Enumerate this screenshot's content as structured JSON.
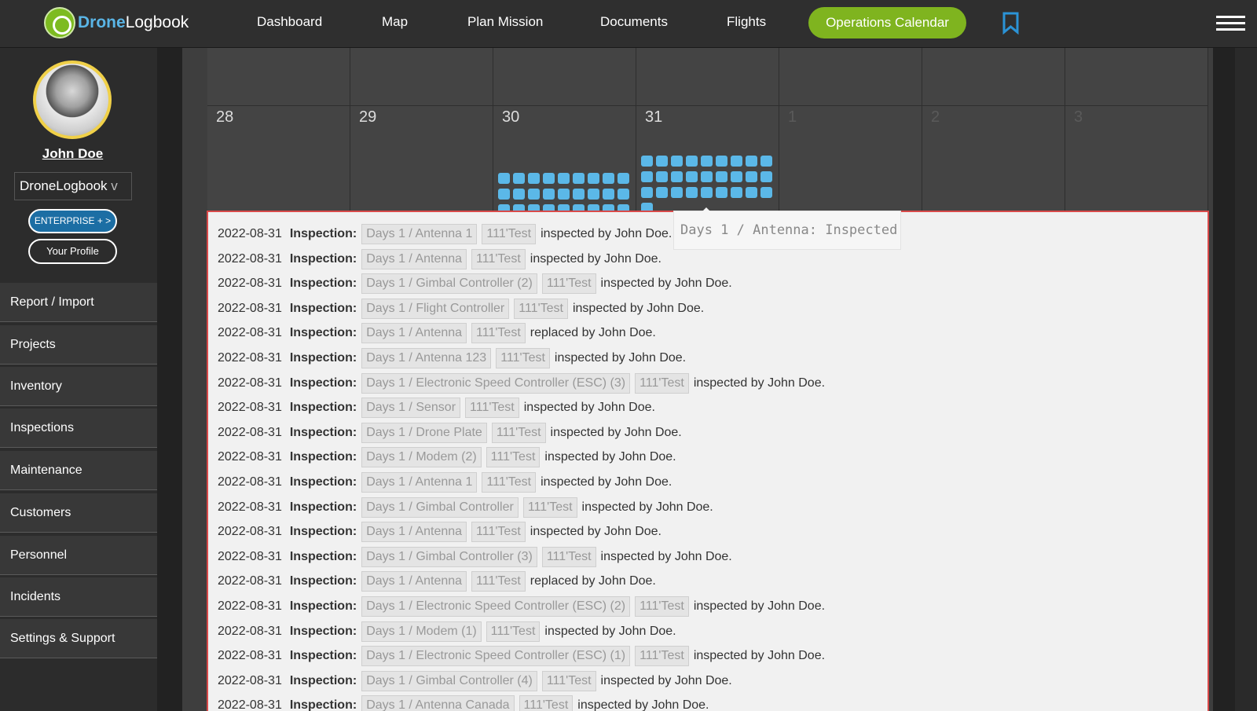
{
  "app": {
    "brand_a": "Drone",
    "brand_b": "Logbook"
  },
  "nav": [
    "Dashboard",
    "Map",
    "Plan Mission",
    "Documents",
    "Flights"
  ],
  "nav_cta": "Operations Calendar",
  "colors": {
    "accent_green": "#7fb41f",
    "brand_blue": "#5ab5e6",
    "badge_blue": "#5bb8e8",
    "highlight_red": "#d94a4a"
  },
  "user": {
    "name": "John Doe",
    "org": "DroneLogbook",
    "org_caret": "v",
    "plan_btn": "ENTERPRISE + >",
    "profile_btn": "Your Profile"
  },
  "sidebar": [
    "Report / Import",
    "Projects",
    "Inventory",
    "Inspections",
    "Maintenance",
    "Customers",
    "Personnel",
    "Incidents",
    "Settings & Support"
  ],
  "calendar": {
    "days": [
      "28",
      "29",
      "30",
      "31",
      "1",
      "2",
      "3"
    ],
    "badge_counts": {
      "30": 27,
      "31": 28
    }
  },
  "tooltip": "Days 1 / Antenna: Inspected",
  "inspections": [
    {
      "date": "2022-08-31",
      "kind": "Inspection:",
      "item": "Days 1 / Antenna 1",
      "tag": "111'Test",
      "action": "inspected by John Doe."
    },
    {
      "date": "2022-08-31",
      "kind": "Inspection:",
      "item": "Days 1 / Antenna",
      "tag": "111'Test",
      "action": "inspected by John Doe."
    },
    {
      "date": "2022-08-31",
      "kind": "Inspection:",
      "item": "Days 1 / Gimbal Controller (2)",
      "tag": "111'Test",
      "action": "inspected by John Doe."
    },
    {
      "date": "2022-08-31",
      "kind": "Inspection:",
      "item": "Days 1 / Flight Controller",
      "tag": "111'Test",
      "action": "inspected by John Doe."
    },
    {
      "date": "2022-08-31",
      "kind": "Inspection:",
      "item": "Days 1 / Antenna",
      "tag": "111'Test",
      "action": "replaced by John Doe."
    },
    {
      "date": "2022-08-31",
      "kind": "Inspection:",
      "item": "Days 1 / Antenna 123",
      "tag": "111'Test",
      "action": "inspected by John Doe."
    },
    {
      "date": "2022-08-31",
      "kind": "Inspection:",
      "item": "Days 1 / Electronic Speed Controller (ESC) (3)",
      "tag": "111'Test",
      "action": "inspected by John Doe."
    },
    {
      "date": "2022-08-31",
      "kind": "Inspection:",
      "item": "Days 1 / Sensor",
      "tag": "111'Test",
      "action": "inspected by John Doe."
    },
    {
      "date": "2022-08-31",
      "kind": "Inspection:",
      "item": "Days 1 / Drone Plate",
      "tag": "111'Test",
      "action": "inspected by John Doe."
    },
    {
      "date": "2022-08-31",
      "kind": "Inspection:",
      "item": "Days 1 / Modem (2)",
      "tag": "111'Test",
      "action": "inspected by John Doe."
    },
    {
      "date": "2022-08-31",
      "kind": "Inspection:",
      "item": "Days 1 / Antenna 1",
      "tag": "111'Test",
      "action": "inspected by John Doe."
    },
    {
      "date": "2022-08-31",
      "kind": "Inspection:",
      "item": "Days 1 / Gimbal Controller",
      "tag": "111'Test",
      "action": "inspected by John Doe."
    },
    {
      "date": "2022-08-31",
      "kind": "Inspection:",
      "item": "Days 1 / Antenna",
      "tag": "111'Test",
      "action": "inspected by John Doe."
    },
    {
      "date": "2022-08-31",
      "kind": "Inspection:",
      "item": "Days 1 / Gimbal Controller (3)",
      "tag": "111'Test",
      "action": "inspected by John Doe."
    },
    {
      "date": "2022-08-31",
      "kind": "Inspection:",
      "item": "Days 1 / Antenna",
      "tag": "111'Test",
      "action": "replaced by John Doe."
    },
    {
      "date": "2022-08-31",
      "kind": "Inspection:",
      "item": "Days 1 / Electronic Speed Controller (ESC) (2)",
      "tag": "111'Test",
      "action": "inspected by John Doe."
    },
    {
      "date": "2022-08-31",
      "kind": "Inspection:",
      "item": "Days 1 / Modem (1)",
      "tag": "111'Test",
      "action": "inspected by John Doe."
    },
    {
      "date": "2022-08-31",
      "kind": "Inspection:",
      "item": "Days 1 / Electronic Speed Controller (ESC) (1)",
      "tag": "111'Test",
      "action": "inspected by John Doe."
    },
    {
      "date": "2022-08-31",
      "kind": "Inspection:",
      "item": "Days 1 / Gimbal Controller (4)",
      "tag": "111'Test",
      "action": "inspected by John Doe."
    },
    {
      "date": "2022-08-31",
      "kind": "Inspection:",
      "item": "Days 1 / Antenna Canada",
      "tag": "111'Test",
      "action": "inspected by John Doe."
    }
  ]
}
